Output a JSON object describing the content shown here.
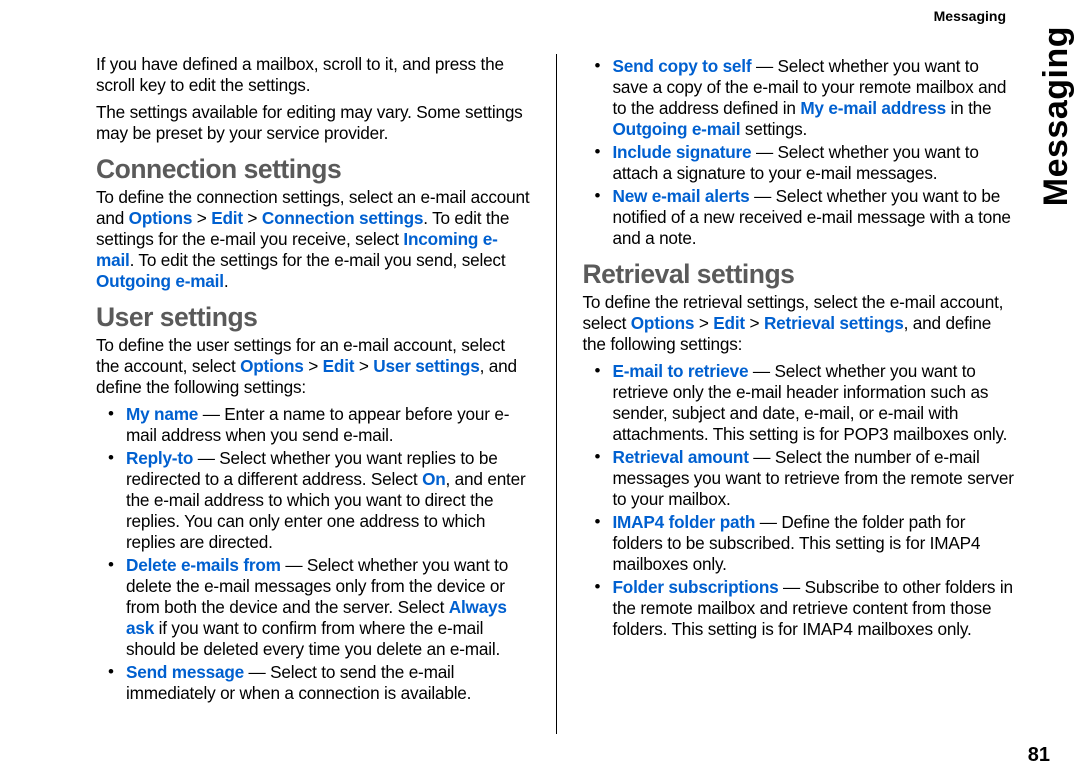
{
  "header": {
    "title": "Messaging"
  },
  "sideTab": "Messaging",
  "pageNumber": "81",
  "left": {
    "intro1": "If you have defined a mailbox, scroll to it, and press the scroll key to edit the settings.",
    "intro2": "The settings available for editing may vary. Some settings may be preset by your service provider.",
    "h_conn": "Connection settings",
    "conn_p_a": "To define the connection settings, select an e-mail account and ",
    "conn_opt": "Options",
    "conn_edit": "Edit",
    "conn_cs": "Connection settings",
    "conn_p_b1": ". To edit the settings for the e-mail you receive, select ",
    "conn_inc": "Incoming e-mail",
    "conn_p_b2": ". To edit the settings for the e-mail you send, select ",
    "conn_out": "Outgoing e-mail",
    "conn_dot": ".",
    "h_user": "User settings",
    "user_p_a": "To define the user settings for an e-mail account, select the account, select ",
    "user_opt": "Options",
    "user_edit": "Edit",
    "user_us": "User settings",
    "user_p_b": ", and define the following settings:",
    "li1_t": "My name",
    "li1_d": " — Enter a name to appear before your e-mail address when you send e-mail.",
    "li2_t": "Reply-to",
    "li2_d1": " — Select whether you want replies to be redirected to a different address. Select ",
    "li2_on": "On",
    "li2_d2": ", and enter the e-mail address to which you want to direct the replies. You can only enter one address to which replies are directed.",
    "li3_t": "Delete e-mails from",
    "li3_d1": " — Select whether you want to delete the e-mail messages only from the device or from both the device and the server. Select ",
    "li3_aa": "Always ask",
    "li3_d2": " if you want to confirm from where the e-mail should be deleted every time you delete an e-mail.",
    "li4_t": "Send message",
    "li4_d": " — Select to send the e-mail immediately or when a connection is available."
  },
  "right": {
    "r1_t": "Send copy to self",
    "r1_d1": " — Select whether you want to save a copy of the e-mail to your remote mailbox and to the address defined in ",
    "r1_mea": "My e-mail address",
    "r1_d2": " in the ",
    "r1_oem": "Outgoing e-mail",
    "r1_d3": " settings.",
    "r2_t": "Include signature",
    "r2_d": " — Select whether you want to attach a signature to your e-mail messages.",
    "r3_t": "New e-mail alerts",
    "r3_d": " — Select whether you want to be notified of a new received e-mail message with a tone and a note.",
    "h_ret": "Retrieval settings",
    "ret_p_a": "To define the retrieval settings, select the e-mail account, select ",
    "ret_opt": "Options",
    "ret_edit": "Edit",
    "ret_rs": "Retrieval settings",
    "ret_p_b": ", and define the following settings:",
    "rli1_t": "E-mail to retrieve",
    "rli1_d": " — Select whether you want to retrieve only the e-mail header information such as sender, subject and date, e-mail, or e-mail with attachments. This setting is for POP3 mailboxes only.",
    "rli2_t": "Retrieval amount",
    "rli2_d": " — Select the number of e-mail messages you want to retrieve from the remote server to your mailbox.",
    "rli3_t": "IMAP4 folder path",
    "rli3_d": " — Define the folder path for folders to be subscribed. This setting is for IMAP4 mailboxes only.",
    "rli4_t": "Folder subscriptions",
    "rli4_d": " — Subscribe to other folders in the remote mailbox and retrieve content from those folders. This setting is for IMAP4 mailboxes only."
  },
  "sep": " > "
}
